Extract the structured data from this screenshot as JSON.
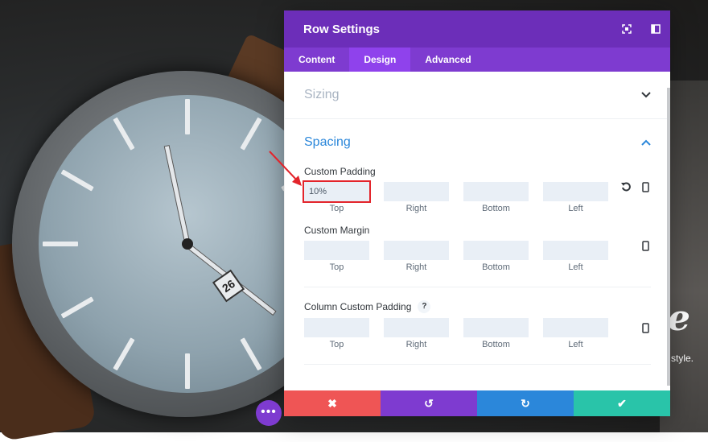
{
  "background": {
    "date_window": "26",
    "heading_fragment": "e",
    "text_fragment": "style.",
    "fab_icon": "dots-icon"
  },
  "modal": {
    "title": "Row Settings",
    "header_icons": [
      "fullscreen-icon",
      "split-view-icon"
    ],
    "tabs": [
      {
        "label": "Content",
        "active": false
      },
      {
        "label": "Design",
        "active": true
      },
      {
        "label": "Advanced",
        "active": false
      }
    ],
    "sections": {
      "sizing": {
        "title": "Sizing",
        "chevron": "chevron-down-icon"
      },
      "spacing": {
        "title": "Spacing",
        "chevron": "chevron-up-icon"
      }
    },
    "custom_padding": {
      "label": "Custom Padding",
      "fields": [
        {
          "label": "Top",
          "value": "10%"
        },
        {
          "label": "Right",
          "value": ""
        },
        {
          "label": "Bottom",
          "value": ""
        },
        {
          "label": "Left",
          "value": ""
        }
      ]
    },
    "custom_margin": {
      "label": "Custom Margin",
      "fields": [
        {
          "label": "Top",
          "value": ""
        },
        {
          "label": "Right",
          "value": ""
        },
        {
          "label": "Bottom",
          "value": ""
        },
        {
          "label": "Left",
          "value": ""
        }
      ]
    },
    "column_padding": {
      "label": "Column Custom Padding",
      "help": "?",
      "fields": [
        {
          "label": "Top",
          "value": ""
        },
        {
          "label": "Right",
          "value": ""
        },
        {
          "label": "Bottom",
          "value": ""
        },
        {
          "label": "Left",
          "value": ""
        }
      ]
    },
    "footer": {
      "discard": "✖",
      "undo": "↺",
      "redo": "↻",
      "save": "✔"
    }
  },
  "colors": {
    "header": "#6c2eb9",
    "tabs": "#7e3bd0",
    "accent_blue": "#2b87da",
    "discard": "#ef5555",
    "save": "#29c4a9",
    "highlight": "#e3242b"
  }
}
